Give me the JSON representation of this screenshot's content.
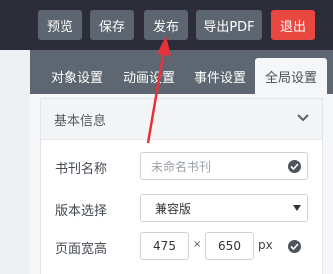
{
  "toolbar": {
    "preview": "预览",
    "save": "保存",
    "publish": "发布",
    "export_pdf": "导出PDF",
    "exit": "退出"
  },
  "tabs": [
    {
      "label": "对象设置"
    },
    {
      "label": "动画设置"
    },
    {
      "label": "事件设置"
    },
    {
      "label": "全局设置",
      "active": true
    }
  ],
  "section": {
    "title": "基本信息",
    "chevron_icon": "chevron-down-icon"
  },
  "form": {
    "title_label": "书刊名称",
    "title_placeholder": "未命名书刊",
    "version_label": "版本选择",
    "version_value": "兼容版",
    "size_label": "页面宽高",
    "width": "475",
    "times": "×",
    "height": "650",
    "unit": "px"
  },
  "colors": {
    "topbar": "#2c2d39",
    "button": "#5d6670",
    "exit_button": "#e8483f",
    "annotation_arrow": "#e8323a"
  }
}
